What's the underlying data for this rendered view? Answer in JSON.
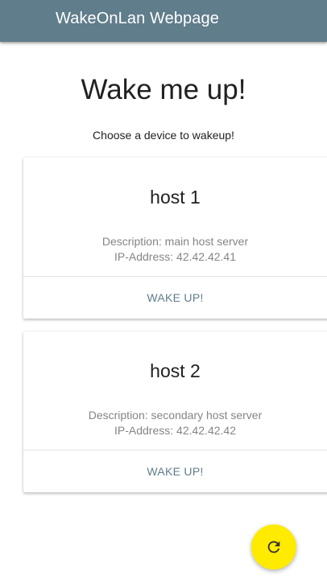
{
  "app_bar": {
    "title": "WakeOnLan Webpage",
    "color": "#607d8b"
  },
  "page": {
    "title": "Wake me up!",
    "subtitle": "Choose a device to wakeup!"
  },
  "devices": [
    {
      "name": "host 1",
      "description": "Description: main host server",
      "ip": "IP-Address: 42.42.42.41",
      "action_label": "WAKE UP!"
    },
    {
      "name": "host 2",
      "description": "Description: secondary host server",
      "ip": "IP-Address: 42.42.42.42",
      "action_label": "WAKE UP!"
    }
  ],
  "fab": {
    "icon": "refresh-icon",
    "color": "#ffeb00"
  }
}
